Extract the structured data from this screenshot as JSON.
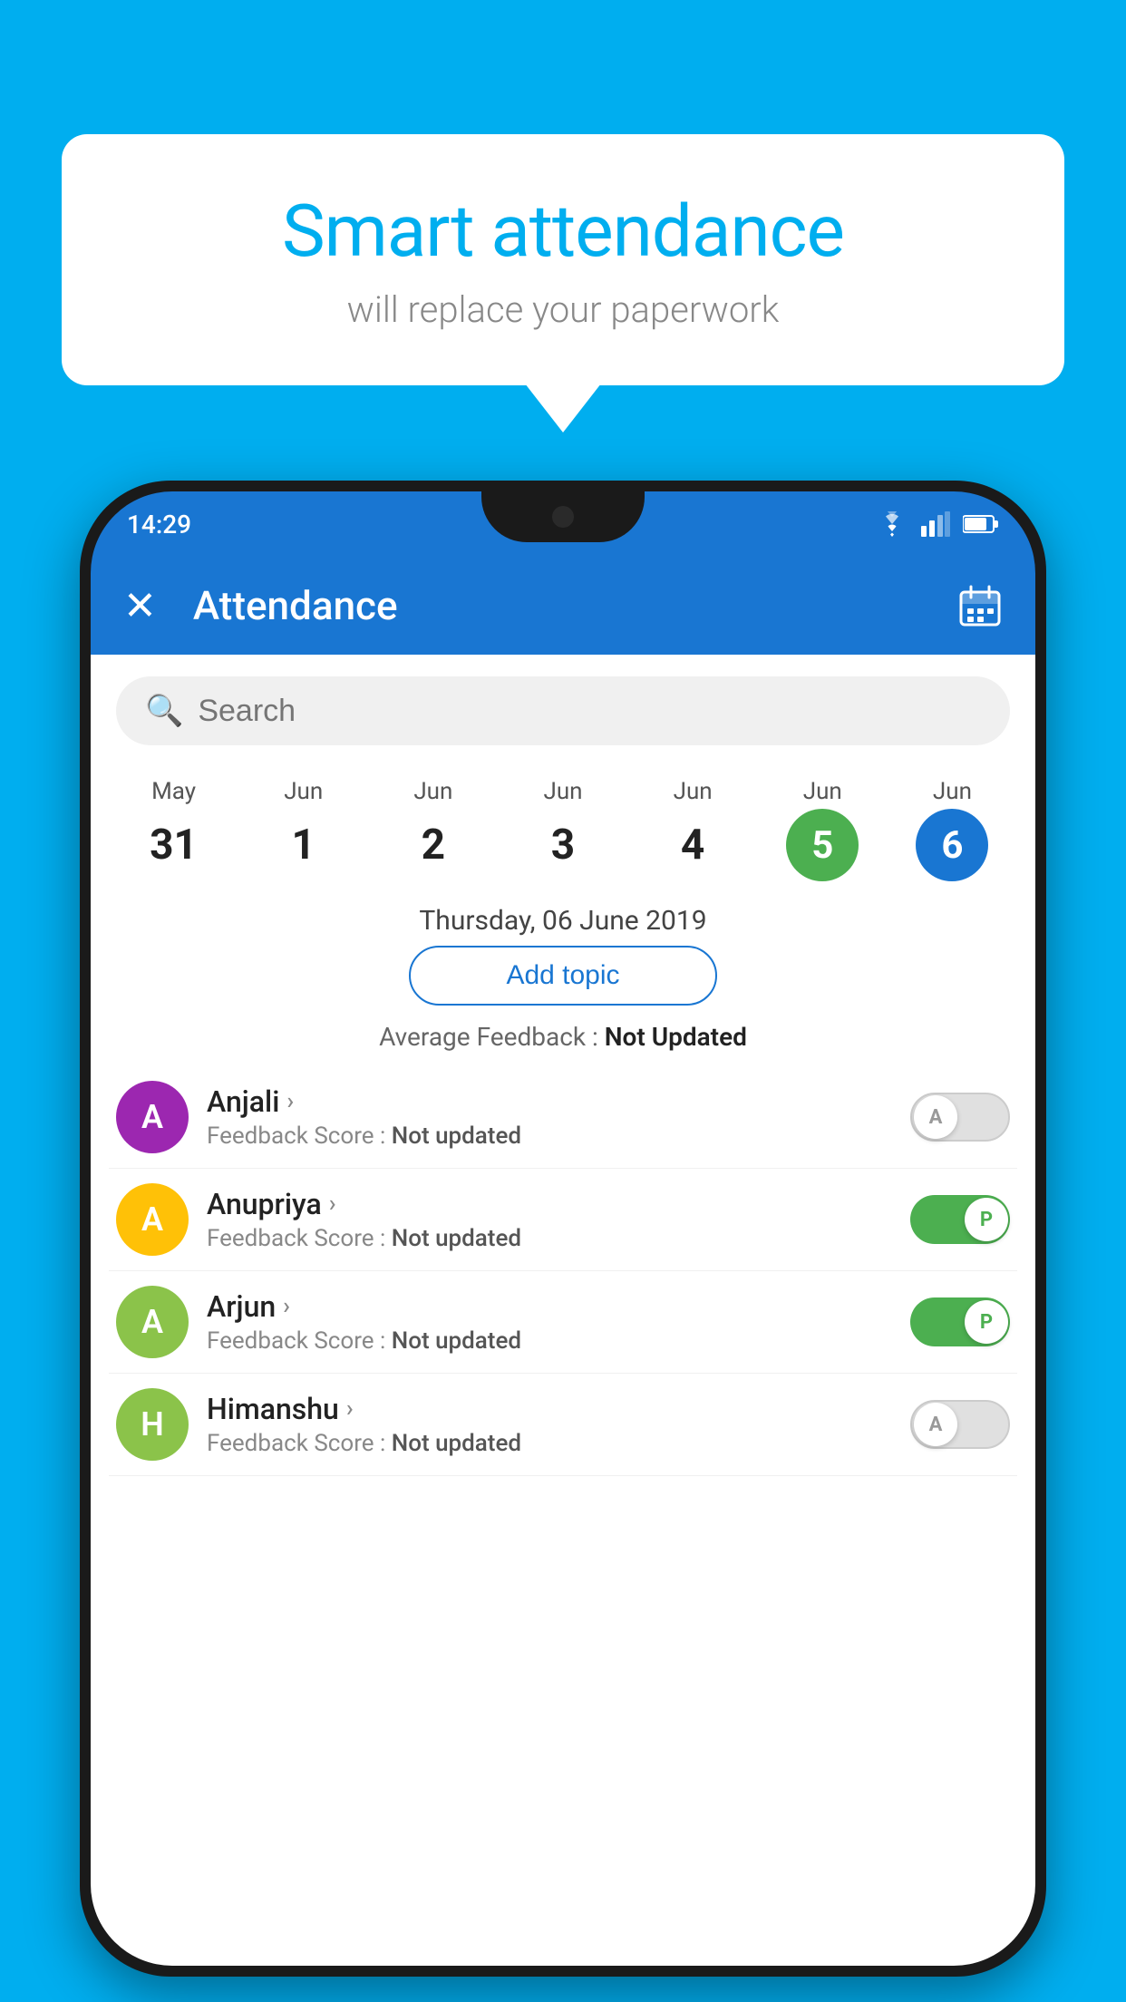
{
  "background_color": "#00AEEF",
  "speech_bubble": {
    "title": "Smart attendance",
    "subtitle": "will replace your paperwork"
  },
  "phone": {
    "status_bar": {
      "time": "14:29"
    },
    "app_bar": {
      "close_label": "✕",
      "title": "Attendance"
    },
    "search": {
      "placeholder": "Search"
    },
    "date_strip": {
      "dates": [
        {
          "month": "May",
          "day": "31",
          "style": "normal"
        },
        {
          "month": "Jun",
          "day": "1",
          "style": "normal"
        },
        {
          "month": "Jun",
          "day": "2",
          "style": "normal"
        },
        {
          "month": "Jun",
          "day": "3",
          "style": "normal"
        },
        {
          "month": "Jun",
          "day": "4",
          "style": "normal"
        },
        {
          "month": "Jun",
          "day": "5",
          "style": "green"
        },
        {
          "month": "Jun",
          "day": "6",
          "style": "blue"
        }
      ]
    },
    "selected_date": "Thursday, 06 June 2019",
    "add_topic_label": "Add topic",
    "avg_feedback_label": "Average Feedback : ",
    "avg_feedback_value": "Not Updated",
    "students": [
      {
        "name": "Anjali",
        "avatar_letter": "A",
        "avatar_color": "#9C27B0",
        "feedback_label": "Feedback Score : ",
        "feedback_value": "Not updated",
        "toggle": "off",
        "toggle_letter": "A"
      },
      {
        "name": "Anupriya",
        "avatar_letter": "A",
        "avatar_color": "#FFC107",
        "feedback_label": "Feedback Score : ",
        "feedback_value": "Not updated",
        "toggle": "on",
        "toggle_letter": "P"
      },
      {
        "name": "Arjun",
        "avatar_letter": "A",
        "avatar_color": "#8BC34A",
        "feedback_label": "Feedback Score : ",
        "feedback_value": "Not updated",
        "toggle": "on",
        "toggle_letter": "P"
      },
      {
        "name": "Himanshu",
        "avatar_letter": "H",
        "avatar_color": "#8BC34A",
        "feedback_label": "Feedback Score : ",
        "feedback_value": "Not updated",
        "toggle": "off",
        "toggle_letter": "A"
      }
    ]
  }
}
